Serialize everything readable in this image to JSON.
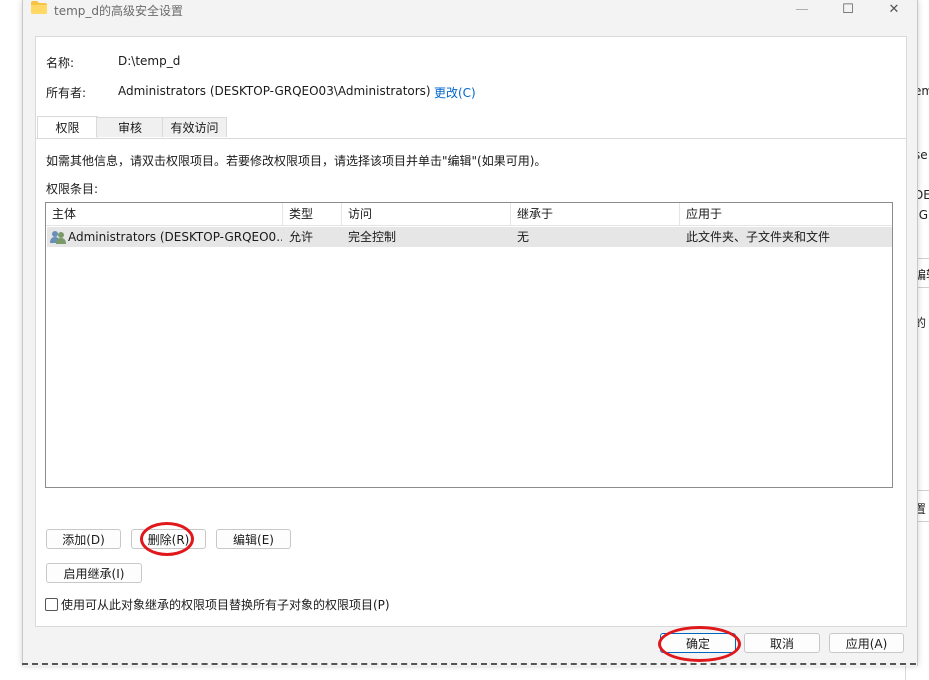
{
  "window": {
    "title": "temp_d的高级安全设置",
    "minimize_glyph": "—",
    "maximize_glyph": "☐",
    "close_glyph": "✕"
  },
  "header": {
    "name_label": "名称:",
    "name_value": "D:\\temp_d",
    "owner_label": "所有者:",
    "owner_value": "Administrators (DESKTOP-GRQEO03\\Administrators)",
    "change_link": "更改(C)"
  },
  "tabs": [
    {
      "label": "权限"
    },
    {
      "label": "审核"
    },
    {
      "label": "有效访问"
    }
  ],
  "info_text": "如需其他信息，请双击权限项目。若要修改权限项目，请选择该项目并单击\"编辑\"(如果可用)。",
  "entries_label": "权限条目:",
  "table": {
    "columns": [
      "主体",
      "类型",
      "访问",
      "继承于",
      "应用于"
    ],
    "rows": [
      {
        "principal": "Administrators (DESKTOP-GRQEO0...",
        "type": "允许",
        "access": "完全控制",
        "inherited_from": "无",
        "applies_to": "此文件夹、子文件夹和文件"
      }
    ]
  },
  "buttons": {
    "add": "添加(D)",
    "remove": "删除(R)",
    "edit": "编辑(E)",
    "enable_inheritance": "启用继承(I)",
    "ok": "确定",
    "cancel": "取消",
    "apply": "应用(A)"
  },
  "replace_checkbox_label": "使用可从此对象继承的权限项目替换所有子对象的权限项目(P)",
  "background_fragments": [
    "em",
    "se",
    "DE",
    "-G",
    "编辑",
    "的",
    "置"
  ],
  "colors": {
    "accent": "#0067c0",
    "link": "#0066cc",
    "annotation_red": "#e0181b",
    "folder_yellow": "#f6c342"
  }
}
